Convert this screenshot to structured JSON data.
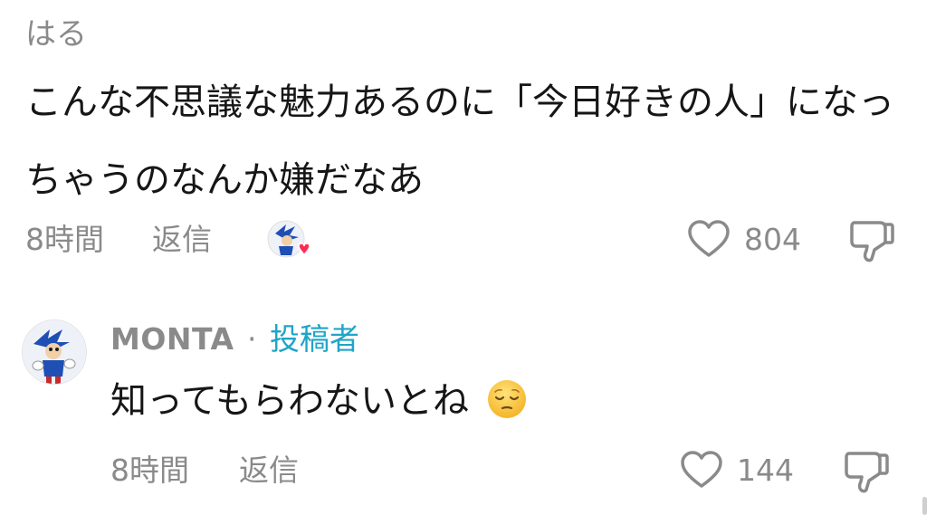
{
  "comment": {
    "author": "はる",
    "text": "こんな不思議な魅力あるのに「今日好きの人」になっちゃうのなんか嫌だなあ",
    "time": "8時間",
    "reply_label": "返信",
    "like_count": "804",
    "icons": {
      "creator_liked": "creator-liked-avatar-heart-icon",
      "like": "heart-outline-icon",
      "dislike": "thumbs-down-icon"
    }
  },
  "reply": {
    "author": "MONTA",
    "separator": "·",
    "badge": "投稿者",
    "text": "知ってもらわないとね",
    "emoji": "pensive-face-emoji",
    "time": "8時間",
    "reply_label": "返信",
    "like_count": "144",
    "icons": {
      "like": "heart-outline-icon",
      "dislike": "thumbs-down-icon"
    }
  },
  "colors": {
    "text_primary": "#161616",
    "text_secondary": "#8a8a8a",
    "creator_badge": "#1ea5c8",
    "heart_badge": "#fe2c55"
  }
}
